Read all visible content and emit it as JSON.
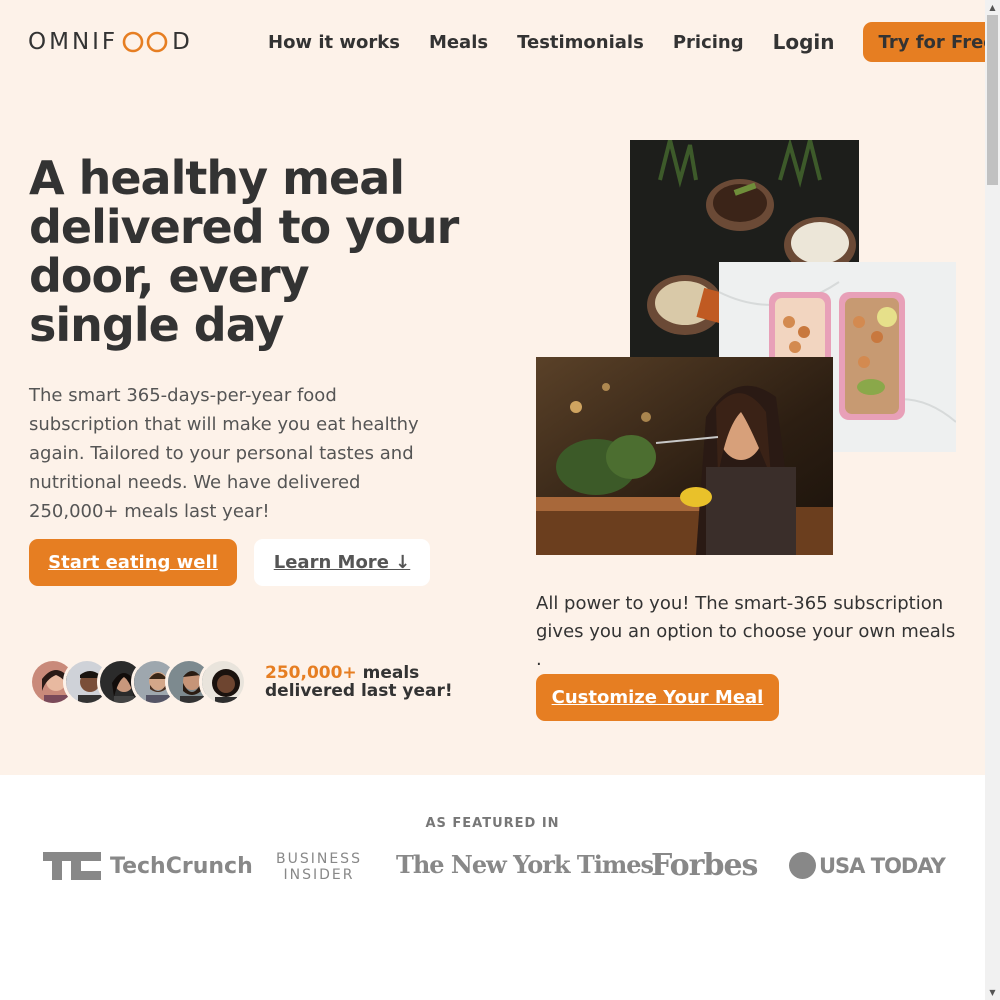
{
  "header": {
    "logo_text_left": "OMNIF",
    "logo_text_right": "D",
    "nav": [
      "How it works",
      "Meals",
      "Testimonials",
      "Pricing"
    ],
    "login": "Login",
    "cta": "Try for Free"
  },
  "hero": {
    "title": "A healthy meal delivered to your door, every single day",
    "description": "The smart 365-days-per-year food subscription that will make you eat healthy again. Tailored to your personal tastes and nutritional needs. We have delivered 250,000+ meals last year!",
    "start_button": "Start eating well",
    "learn_button": "Learn More ↓",
    "delivered_number": "250,000+",
    "delivered_text_1": " meals",
    "delivered_text_2": "delivered last year!"
  },
  "side": {
    "power_text": "All power to you! The smart-365 subscription gives you an option to choose your own meals .",
    "customize_button": "Customize Your Meal"
  },
  "featured": {
    "label": "AS FEATURED IN",
    "logos": [
      "TechCrunch",
      "BUSINESS",
      "INSIDER",
      "The New York Times",
      "Forbes",
      "USA TODAY"
    ]
  },
  "colors": {
    "accent": "#e67e22",
    "hero_bg": "#fdf2e9",
    "text": "#333333"
  }
}
